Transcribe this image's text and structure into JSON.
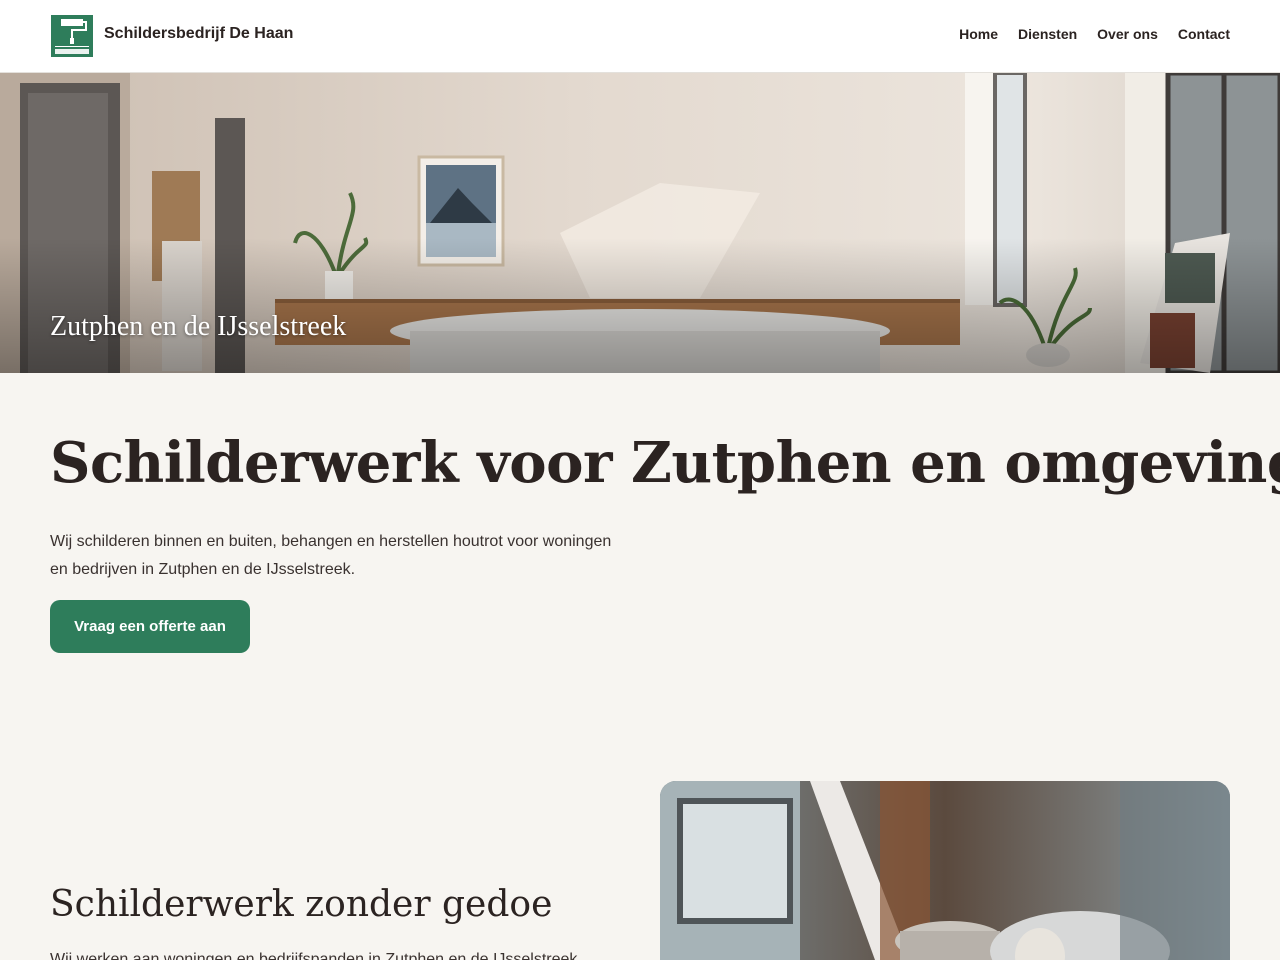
{
  "header": {
    "logo_alt_text": "SCHILDERSBEDRIJF DE HAAN",
    "brand_name": "Schildersbedrijf De Haan",
    "nav": [
      {
        "label": "Home"
      },
      {
        "label": "Diensten"
      },
      {
        "label": "Over ons"
      },
      {
        "label": "Contact"
      }
    ]
  },
  "hero": {
    "caption": "Zutphen en de IJsselstreek"
  },
  "intro": {
    "heading": "Schilderwerk voor Zutphen en omgeving",
    "text": "Wij schilderen binnen en buiten, behangen en herstellen houtrot voor woningen en bedrijven in Zutphen en de IJsselstreek.",
    "cta_label": "Vraag een offerte aan"
  },
  "section": {
    "heading": "Schilderwerk zonder gedoe",
    "text": "Wij werken aan woningen en bedrijfspanden in Zutphen en de IJsselstreek."
  },
  "colors": {
    "accent": "#2e7d5b",
    "background": "#f7f5f1",
    "text": "#2b2321"
  }
}
